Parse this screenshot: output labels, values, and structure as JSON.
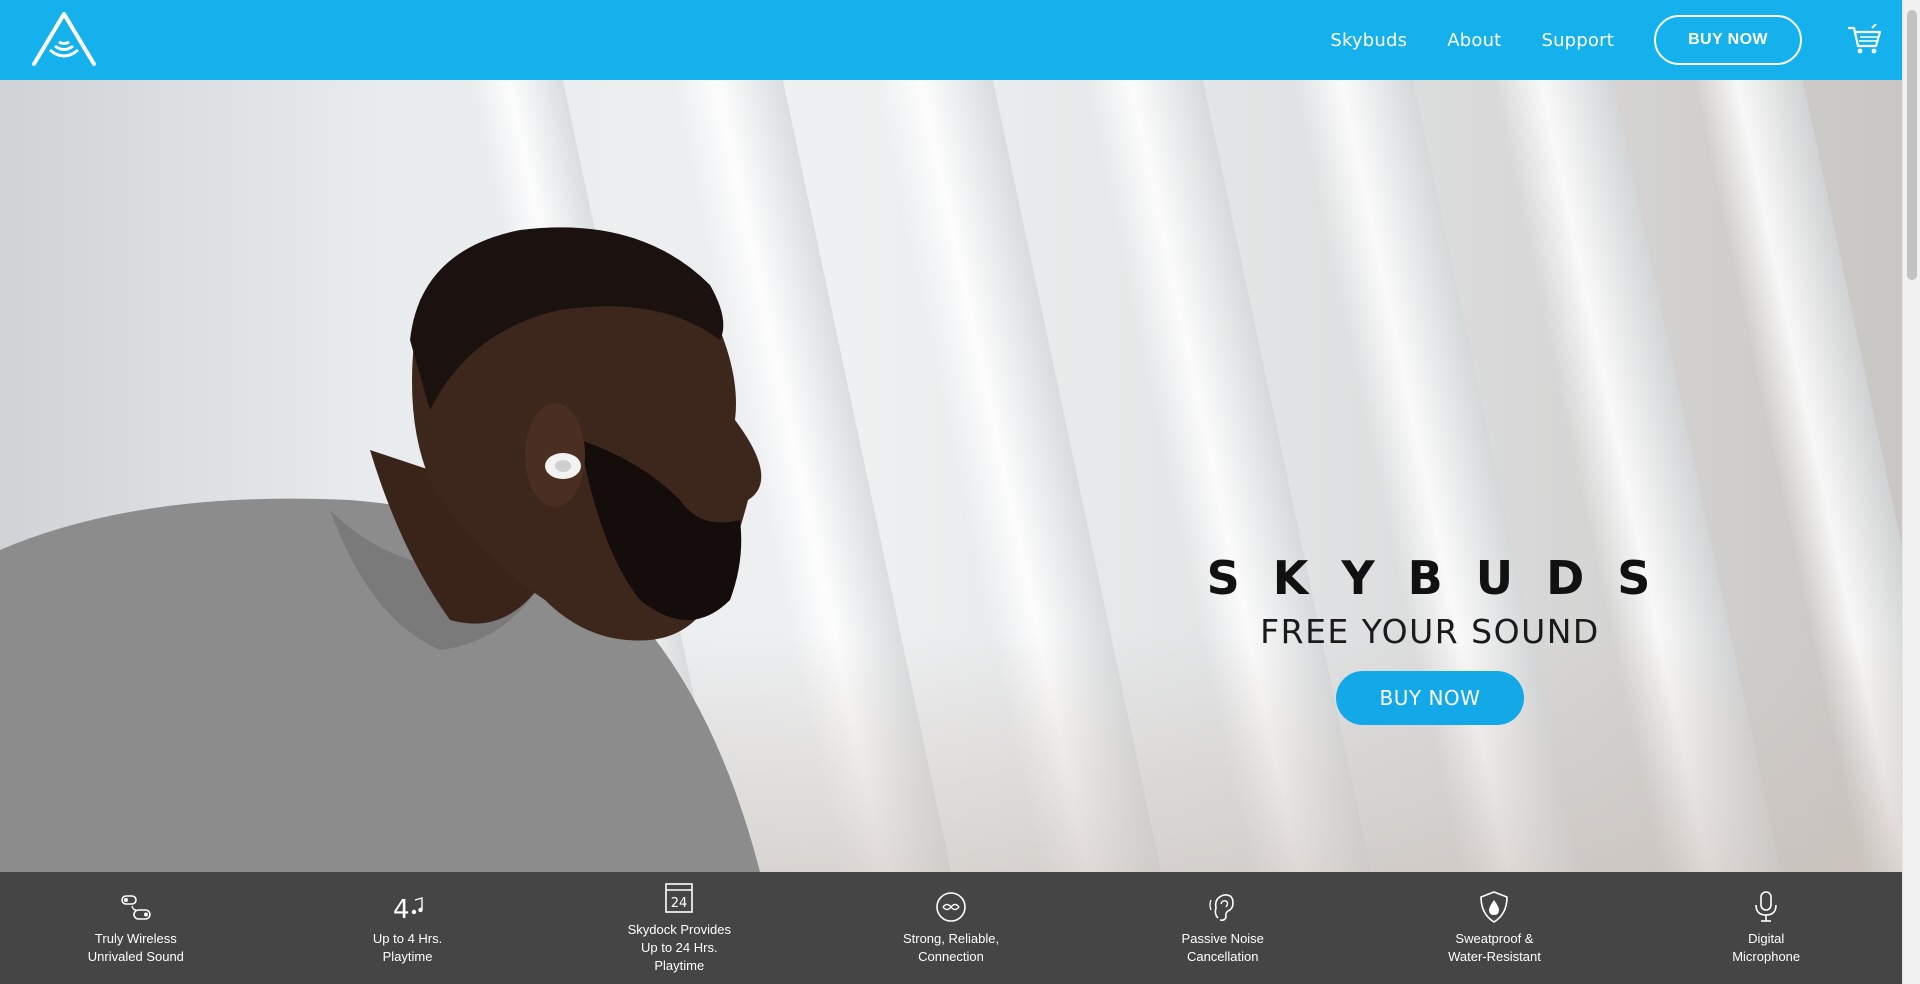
{
  "header": {
    "logo_icon": "sound-triangle-logo",
    "nav": [
      {
        "label": "Skybuds"
      },
      {
        "label": "About"
      },
      {
        "label": "Support"
      }
    ],
    "buy_now_label": "BUY NOW",
    "cart_icon": "cart-icon",
    "brand_color": "#14b1ec"
  },
  "hero": {
    "brand": "SKYBUDS",
    "tagline": "FREE YOUR SOUND",
    "buy_now_label": "BUY NOW",
    "button_color": "#13a8e8"
  },
  "features": [
    {
      "icon": "wireless-earbuds-icon",
      "label": "Truly Wireless\nUnrivaled Sound"
    },
    {
      "icon": "four-hours-music-icon",
      "label": "Up to 4 Hrs.\nPlaytime"
    },
    {
      "icon": "calendar-24-icon",
      "label": "Skydock Provides\nUp to 24 Hrs.\nPlaytime"
    },
    {
      "icon": "connection-icon",
      "label": "Strong, Reliable,\nConnection"
    },
    {
      "icon": "ear-icon",
      "label": "Passive Noise\nCancellation"
    },
    {
      "icon": "water-shield-icon",
      "label": "Sweatproof &\nWater-Resistant"
    },
    {
      "icon": "microphone-icon",
      "label": "Digital\nMicrophone"
    }
  ],
  "feature_icon_texts": {
    "four": "4",
    "twenty_four": "24"
  }
}
